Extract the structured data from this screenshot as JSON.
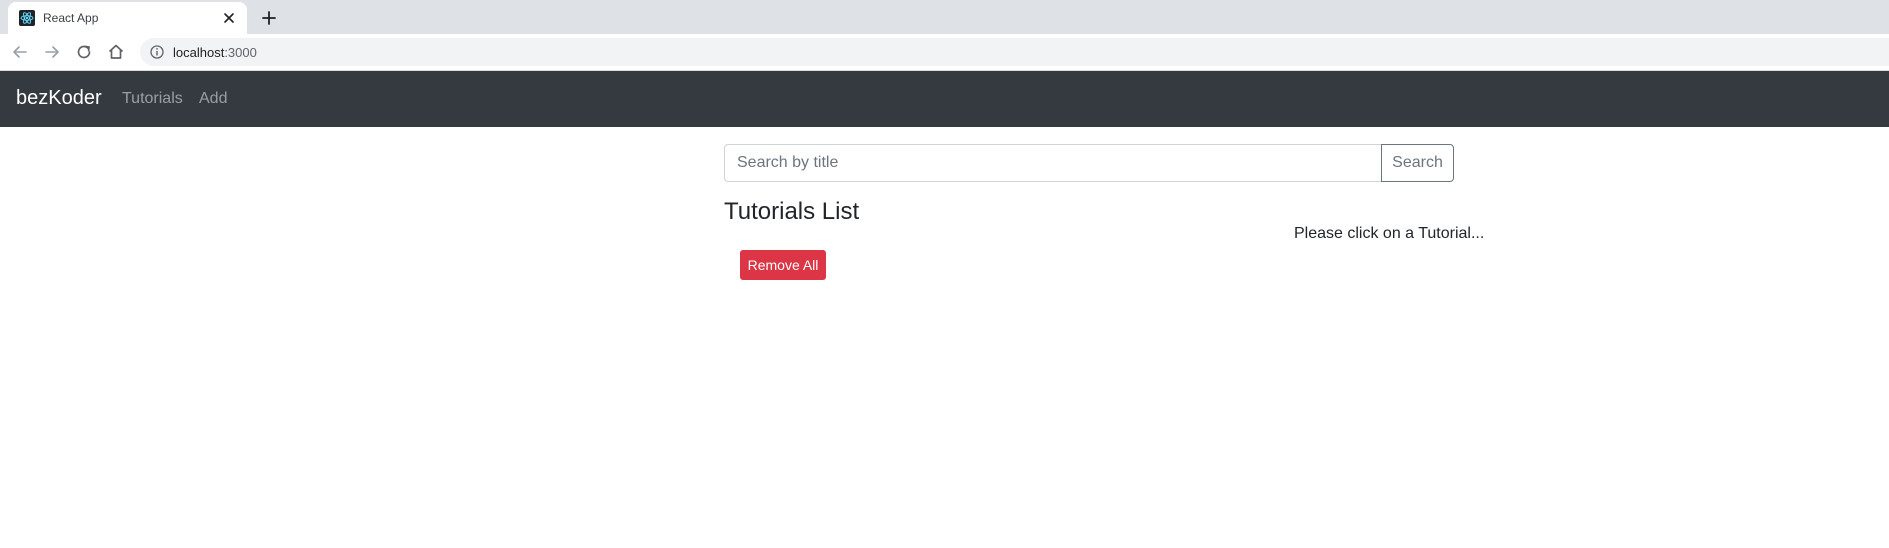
{
  "browser": {
    "tab_title": "React App",
    "url_host": "localhost",
    "url_port": ":3000"
  },
  "navbar": {
    "brand": "bezKoder",
    "links": [
      {
        "label": "Tutorials"
      },
      {
        "label": "Add"
      }
    ]
  },
  "search": {
    "placeholder": "Search by title",
    "value": "",
    "button_label": "Search"
  },
  "tutorials": {
    "title": "Tutorials List",
    "remove_all_label": "Remove All",
    "items": []
  },
  "detail": {
    "placeholder": "Please click on a Tutorial..."
  },
  "colors": {
    "navbar_bg": "#343a40",
    "danger": "#dc3545",
    "secondary": "#6c757d"
  },
  "icons": {
    "favicon": "react-logo-icon",
    "tab_close": "close-icon",
    "new_tab": "plus-icon",
    "back": "arrow-left-icon",
    "forward": "arrow-right-icon",
    "reload": "reload-icon",
    "home": "home-icon",
    "site_info": "info-icon"
  }
}
